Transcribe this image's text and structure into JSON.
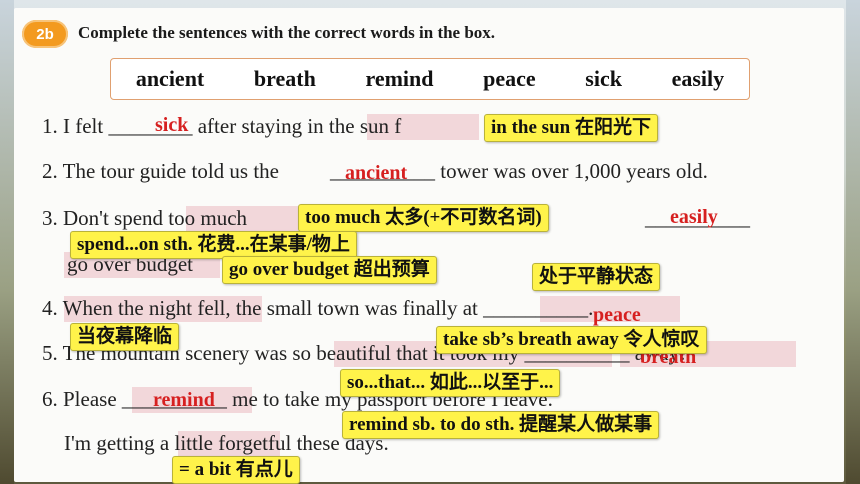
{
  "badge": "2b",
  "instruction": "Complete the sentences with the correct words in the box.",
  "word_box": [
    "ancient",
    "breath",
    "remind",
    "peace",
    "sick",
    "easily"
  ],
  "sentences": {
    "s1": "1. I felt ________ after staying in the sun f",
    "s2a": "2. The tour guide told us the ",
    "s2b": "__________ tower was over 1,000 years old.",
    "s3a": "3. Don't spend too much ",
    "s3b": "__________",
    "s3c": "go over budget",
    "s4": "4. When the night fell, the small town was finally at __________.",
    "s5": "5. The mountain scenery was so beautiful that it took my __________ away!",
    "s6": "6. Please __________ me to take my passport before I leave.",
    "s6b": "I'm getting a little forgetful these days."
  },
  "answers": {
    "a1": "sick",
    "a2": "ancient",
    "a3": "easily",
    "a4": "peace",
    "a5": "breath",
    "a6": "remind"
  },
  "notes": {
    "n1": "in the sun 在阳光下",
    "n2": "too much 太多(+不可数名词)",
    "n3": "spend...on sth. 花费...在某事/物上",
    "n4": "go over budget 超出预算",
    "n5": "处于平静状态",
    "n6": "当夜幕降临",
    "n7": "take sb’s breath away 令人惊叹",
    "n8": "so...that... 如此...以至于...",
    "n9": "remind sb. to do sth. 提醒某人做某事",
    "n10": "= a bit 有点儿"
  }
}
